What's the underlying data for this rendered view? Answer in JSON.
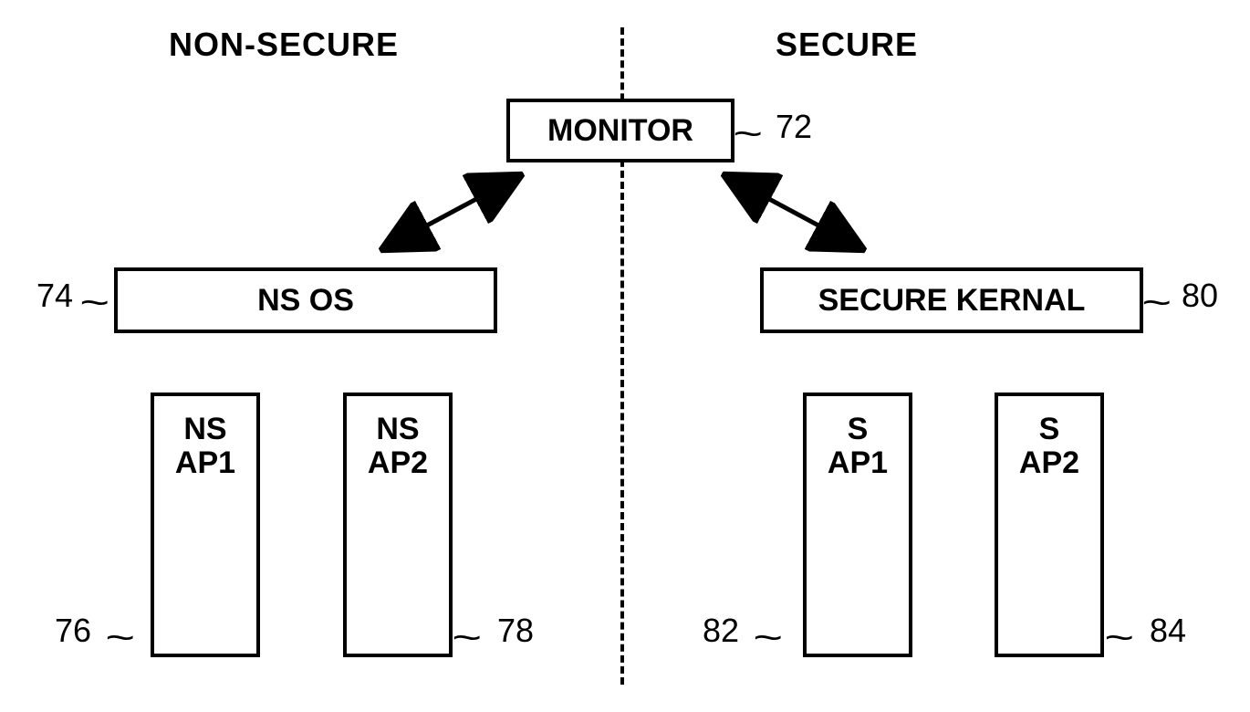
{
  "headers": {
    "left": "NON-SECURE",
    "right": "SECURE"
  },
  "monitor": {
    "label": "MONITOR",
    "ref": "72"
  },
  "ns_os": {
    "label": "NS OS",
    "ref": "74"
  },
  "secure_kernel": {
    "label": "SECURE KERNAL",
    "ref": "80"
  },
  "ns_ap1": {
    "line1": "NS",
    "line2": "AP1",
    "ref": "76"
  },
  "ns_ap2": {
    "line1": "NS",
    "line2": "AP2",
    "ref": "78"
  },
  "s_ap1": {
    "line1": "S",
    "line2": "AP1",
    "ref": "82"
  },
  "s_ap2": {
    "line1": "S",
    "line2": "AP2",
    "ref": "84"
  }
}
